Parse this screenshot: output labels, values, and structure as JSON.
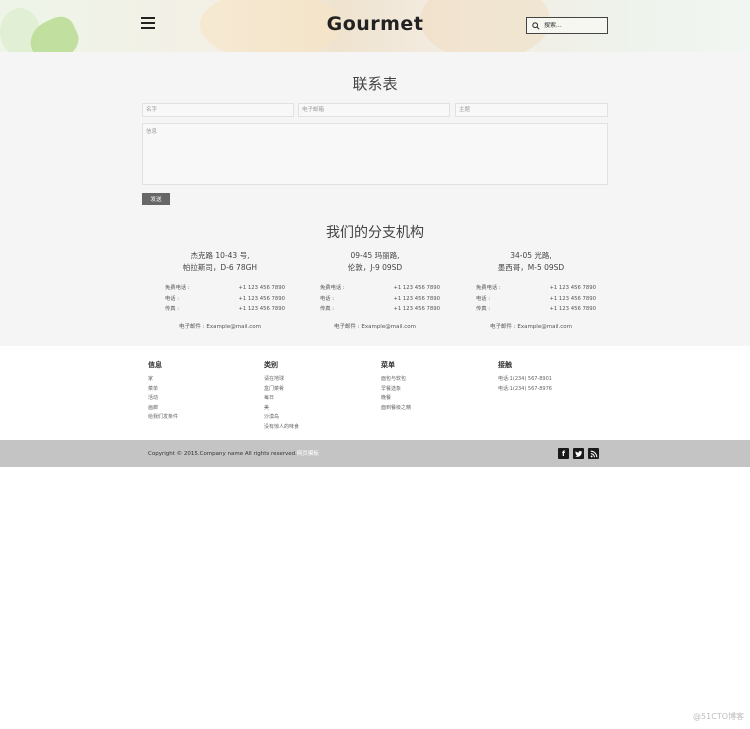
{
  "header": {
    "logo": "Gourmet",
    "search_placeholder": "搜索..."
  },
  "contact_form": {
    "title": "联系表",
    "name_placeholder": "名字",
    "email_placeholder": "电子邮箱",
    "subject_placeholder": "主题",
    "message_placeholder": "信息",
    "submit_label": "发送"
  },
  "branches": {
    "title": "我们的分支机构",
    "items": [
      {
        "address_line1": "杰克路 10-43 号,",
        "address_line2": "帕拉斯司，D-6 78GH",
        "rows": [
          {
            "label": "免费电话 :",
            "value": "+1 123 456 7890"
          },
          {
            "label": "电话 :",
            "value": "+1 123 456 7890"
          },
          {
            "label": "传真 :",
            "value": "+1 123 456 7890"
          }
        ],
        "email": "电子邮件 : Example@mail.com"
      },
      {
        "address_line1": "09-45 玛丽路,",
        "address_line2": "伦敦，J-9 09SD",
        "rows": [
          {
            "label": "免费电话 :",
            "value": "+1 123 456 7890"
          },
          {
            "label": "电话 :",
            "value": "+1 123 456 7890"
          },
          {
            "label": "传真 :",
            "value": "+1 123 456 7890"
          }
        ],
        "email": "电子邮件 : Example@mail.com"
      },
      {
        "address_line1": "34-05 光路,",
        "address_line2": "墨西哥，M-5 09SD",
        "rows": [
          {
            "label": "免费电话 :",
            "value": "+1 123 456 7890"
          },
          {
            "label": "电话 :",
            "value": "+1 123 456 7890"
          },
          {
            "label": "传真 :",
            "value": "+1 123 456 7890"
          }
        ],
        "email": "电子邮件 : Example@mail.com"
      }
    ]
  },
  "footer": {
    "columns": [
      {
        "title": "信息",
        "items": [
          "家",
          "菜单",
          "活动",
          "画廊",
          "给我们发条件"
        ]
      },
      {
        "title": "类别",
        "items": [
          "请在地球",
          "盒门菜肴",
          "每日",
          "美",
          "沙漠岛",
          "没有惊人的味食"
        ]
      },
      {
        "title": "菜单",
        "items": [
          "面包与软包",
          "早餐选象",
          "晚餐",
          "面到餐级之精"
        ]
      },
      {
        "title": "接触",
        "items": [
          "电话:1(234) 567-8901",
          "电话:1(234) 567-8976"
        ]
      }
    ],
    "copyright": "Copyright © 2015.Company name All rights reserved.",
    "copyright_link": "网页模板",
    "social": [
      "facebook-icon",
      "twitter-icon",
      "rss-icon"
    ]
  },
  "watermark": "@51CTO博客"
}
